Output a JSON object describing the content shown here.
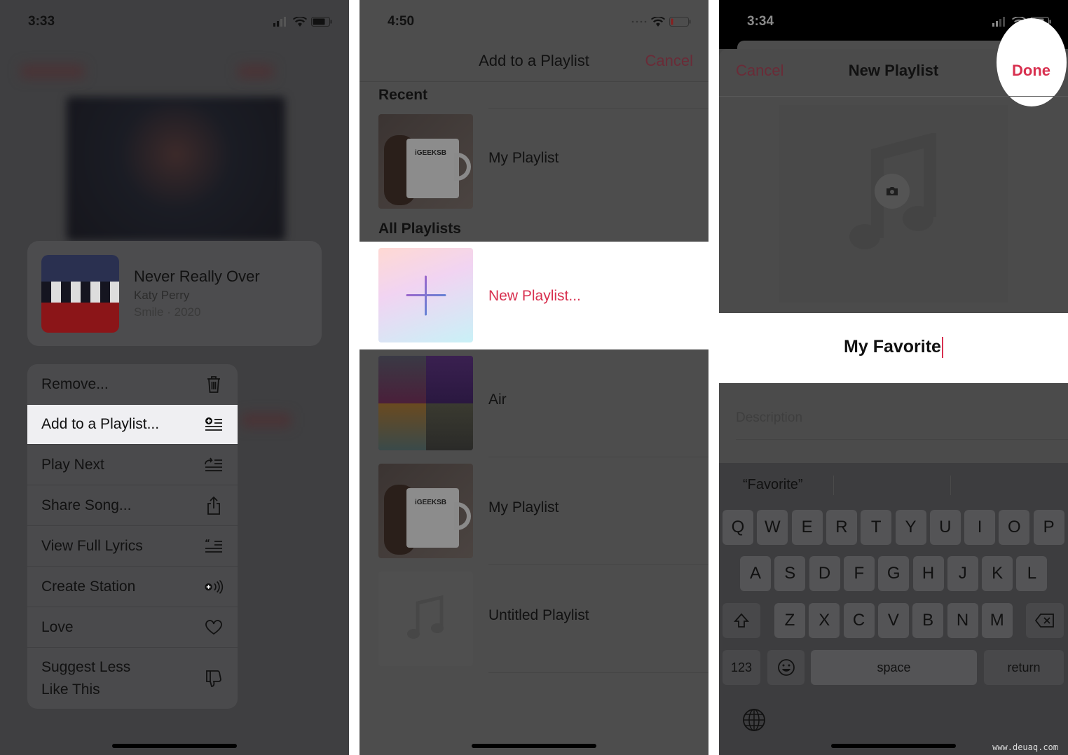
{
  "panel1": {
    "status": {
      "time": "3:33"
    },
    "song": {
      "title": "Never Really Over",
      "artist": "Katy Perry",
      "album_year": "Smile · 2020"
    },
    "menu": [
      {
        "label": "Remove...",
        "icon": "trash-icon",
        "highlighted": false
      },
      {
        "label": "Add to a Playlist...",
        "icon": "add-to-playlist-icon",
        "highlighted": true
      },
      {
        "label": "Play Next",
        "icon": "play-next-icon",
        "highlighted": false
      },
      {
        "label": "Share Song...",
        "icon": "share-icon",
        "highlighted": false
      },
      {
        "label": "View Full Lyrics",
        "icon": "lyrics-icon",
        "highlighted": false
      },
      {
        "label": "Create Station",
        "icon": "station-icon",
        "highlighted": false
      },
      {
        "label": "Love",
        "icon": "heart-icon",
        "highlighted": false
      },
      {
        "label": "Suggest Less\nLike This",
        "icon": "thumbs-down-icon",
        "highlighted": false
      }
    ]
  },
  "panel2": {
    "status": {
      "time": "4:50"
    },
    "title": "Add to a Playlist",
    "cancel": "Cancel",
    "recent_header": "Recent",
    "recent": [
      {
        "name": "My Playlist",
        "art": "mug",
        "art_text": "iGEEKSB"
      }
    ],
    "all_header": "All Playlists",
    "new_playlist": "New Playlist...",
    "playlists": [
      {
        "name": "Air",
        "art": "collage"
      },
      {
        "name": "My Playlist",
        "art": "mug",
        "art_text": "iGEEKSB"
      },
      {
        "name": "Untitled Playlist",
        "art": "music-note"
      }
    ]
  },
  "panel3": {
    "status": {
      "time": "3:34"
    },
    "cancel": "Cancel",
    "title": "New Playlist",
    "done": "Done",
    "name_value": "My Favorite",
    "description_placeholder": "Description",
    "suggestion": "“Favorite”",
    "keyboard": {
      "row1": [
        "Q",
        "W",
        "E",
        "R",
        "T",
        "Y",
        "U",
        "I",
        "O",
        "P"
      ],
      "row2": [
        "A",
        "S",
        "D",
        "F",
        "G",
        "H",
        "J",
        "K",
        "L"
      ],
      "row3": [
        "Z",
        "X",
        "C",
        "V",
        "B",
        "N",
        "M"
      ],
      "numbers": "123",
      "space": "space",
      "return": "return"
    }
  },
  "colors": {
    "accent": "#d8304f",
    "accent_dimmed": "#6a2b37",
    "highlight": "#efeff2"
  },
  "watermark": "www.deuaq.com"
}
